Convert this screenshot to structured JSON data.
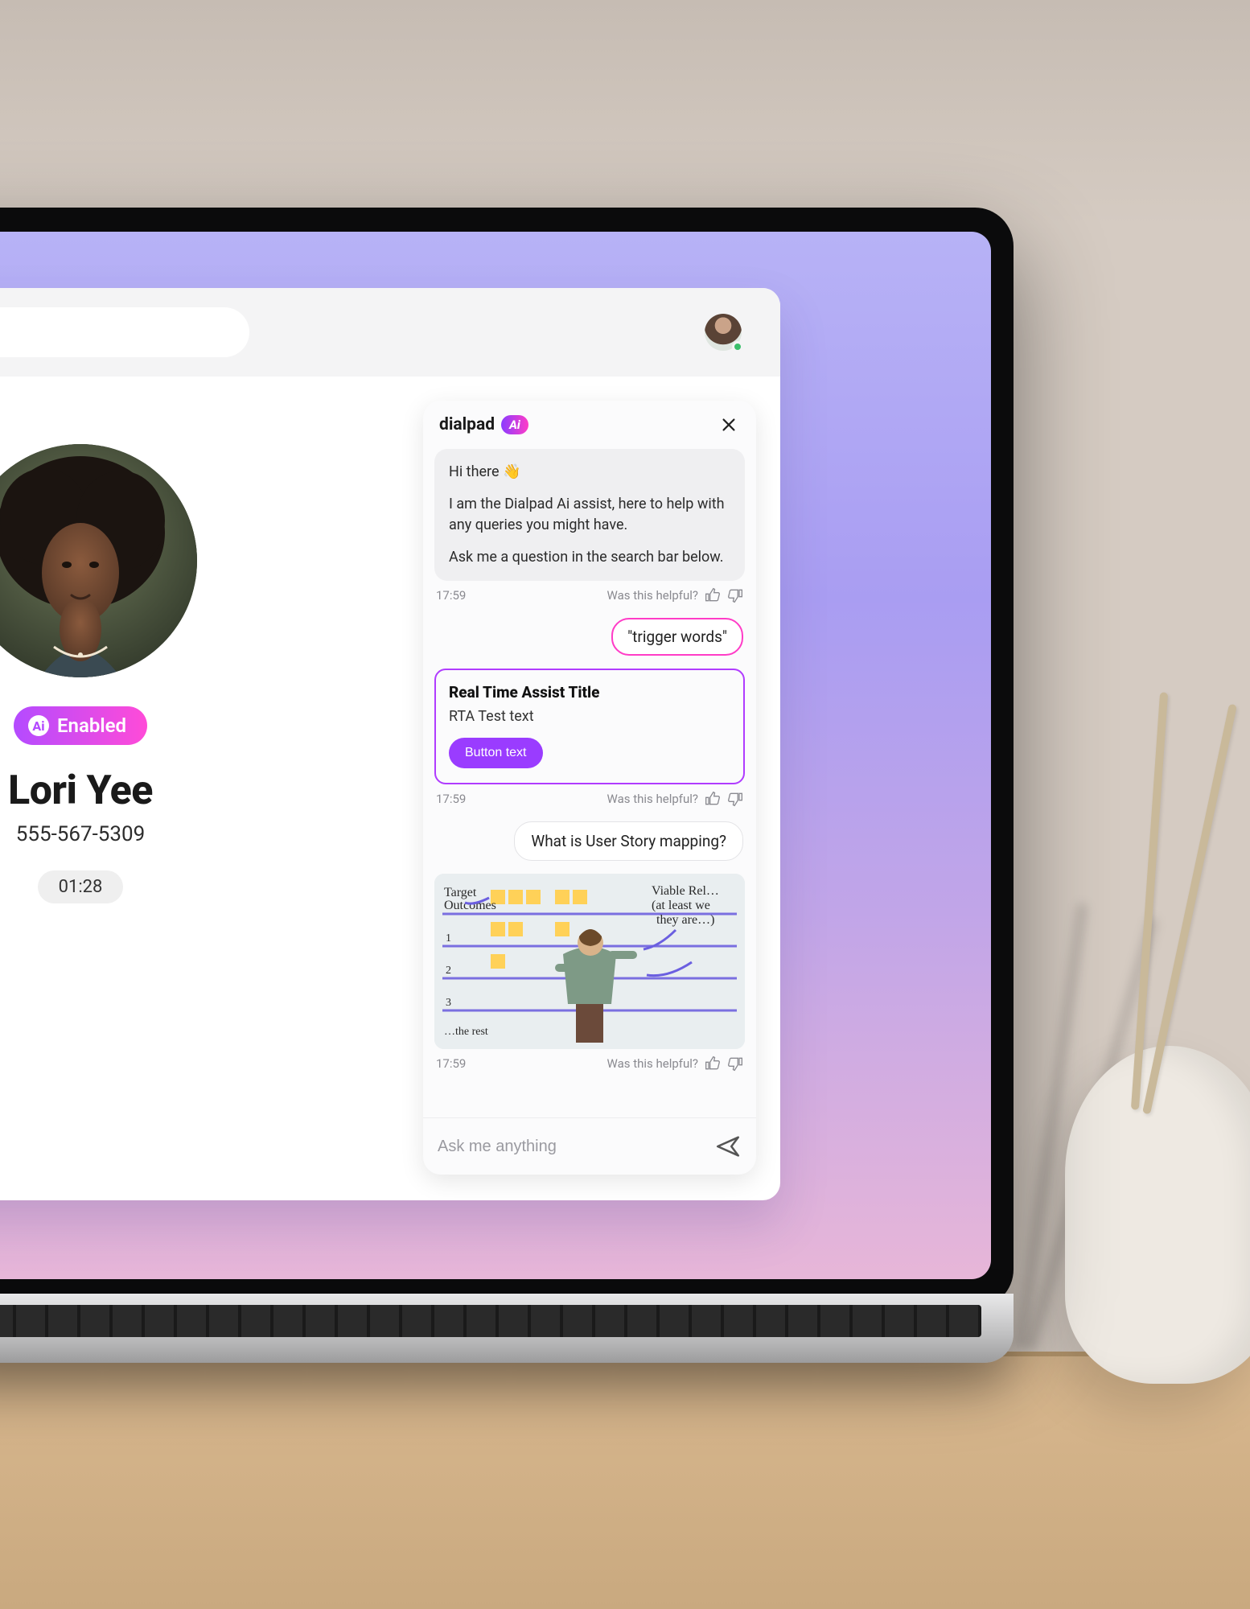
{
  "topbar": {
    "presence": "online"
  },
  "contact": {
    "badge_label": "Enabled",
    "name": "Lori Yee",
    "phone": "555-567-5309",
    "timer": "01:28"
  },
  "chat": {
    "brand_name": "dialpad",
    "brand_badge": "Ai",
    "intro": {
      "line1": "Hi there 👋",
      "line2": "I am the Dialpad Ai assist, here to help with any queries you might have.",
      "line3": "Ask me a question in the search bar below."
    },
    "helpful_label": "Was this helpful?",
    "msg1_time": "17:59",
    "user1": "\"trigger words\"",
    "rta": {
      "title": "Real Time Assist Title",
      "text": "RTA Test text",
      "button": "Button text"
    },
    "msg2_time": "17:59",
    "user2": "What is User Story mapping?",
    "msg3_time": "17:59",
    "image_labels": {
      "left": "Target Outcomes",
      "right": "Viable Release (at least we think they are…)",
      "bottom": "…the rest"
    },
    "input_placeholder": "Ask me anything"
  }
}
